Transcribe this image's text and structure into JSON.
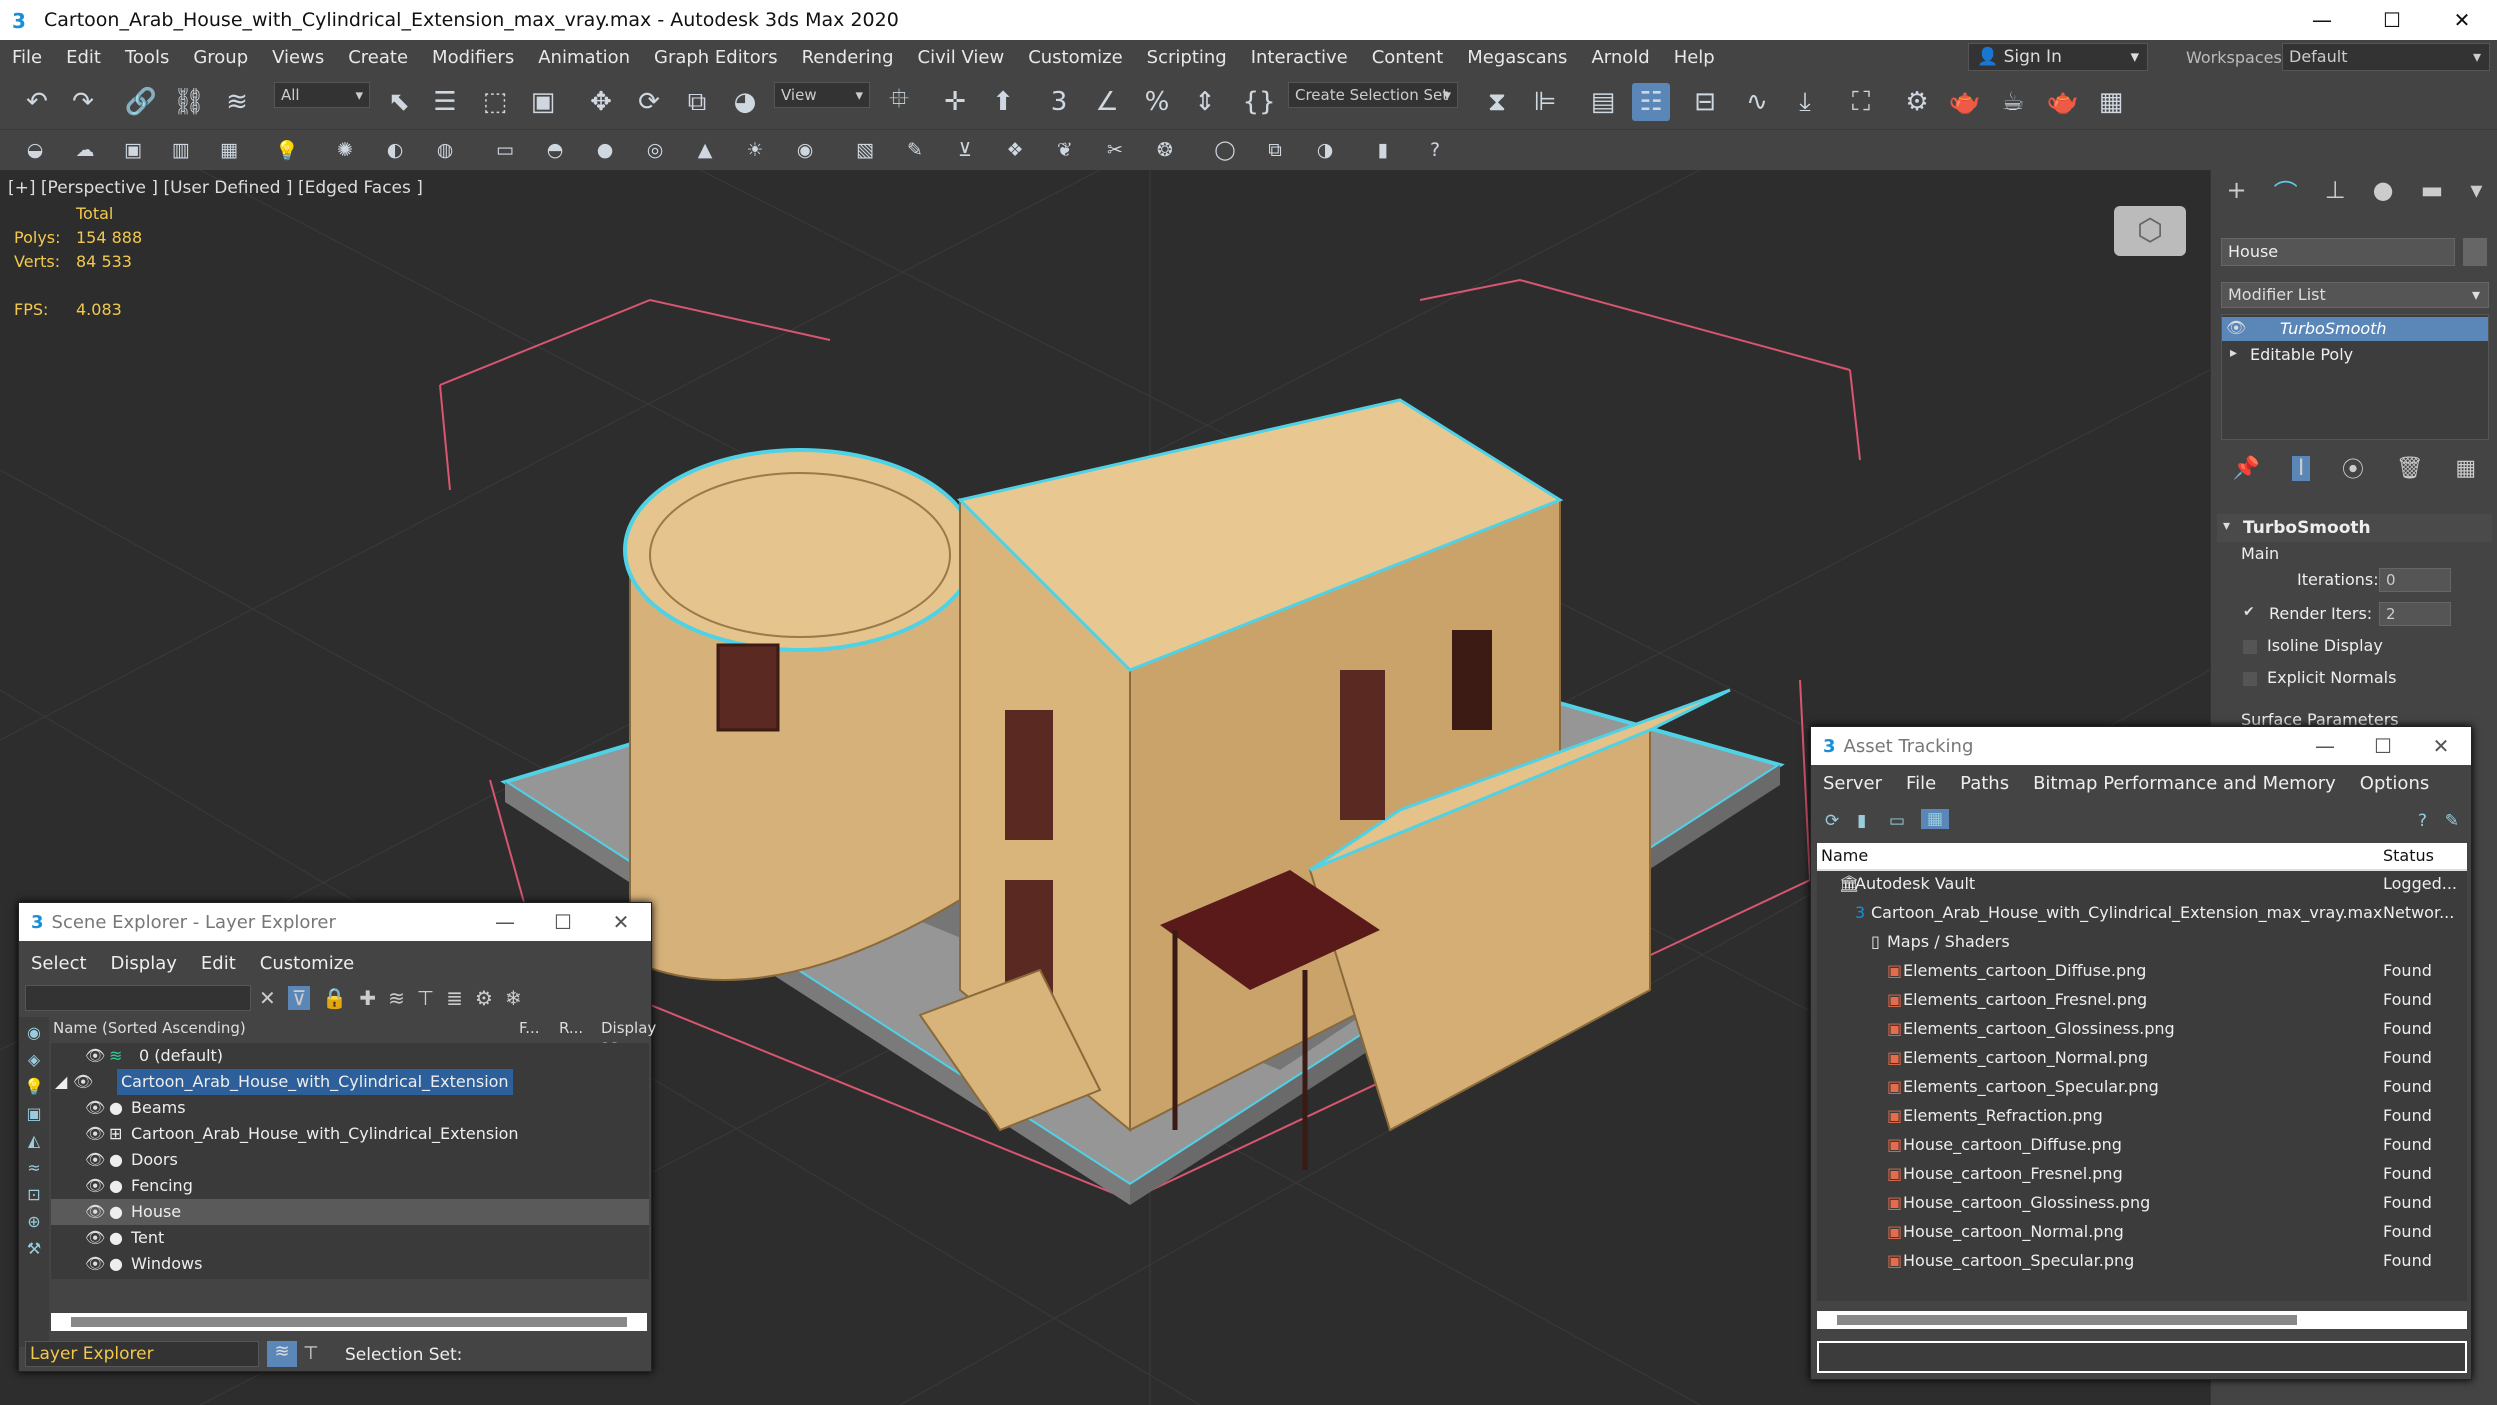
{
  "window": {
    "title": "Cartoon_Arab_House_with_Cylindrical_Extension_max_vray.max - Autodesk 3ds Max 2020",
    "minimize": "—",
    "maximize": "☐",
    "close": "✕"
  },
  "menu": [
    "File",
    "Edit",
    "Tools",
    "Group",
    "Views",
    "Create",
    "Modifiers",
    "Animation",
    "Graph Editors",
    "Rendering",
    "Civil View",
    "Customize",
    "Scripting",
    "Interactive",
    "Content",
    "Megascans",
    "Arnold",
    "Help"
  ],
  "signin": "Sign In",
  "workspaces": {
    "label": "Workspaces:",
    "value": "Default"
  },
  "toolbar": {
    "filter": "All",
    "refcoord": "View",
    "selection_set": "Create Selection Set"
  },
  "viewport": {
    "label": "[+] [Perspective ] [User Defined ] [Edged Faces ]",
    "stats": {
      "total_label": "Total",
      "polys_label": "Polys:",
      "polys": "154 888",
      "verts_label": "Verts:",
      "verts": "84 533",
      "fps_label": "FPS:",
      "fps": "4.083"
    }
  },
  "command_panel": {
    "object_name": "House",
    "modifier_list": "Modifier List",
    "stack": [
      "TurboSmooth",
      "Editable Poly"
    ],
    "rollout": "TurboSmooth",
    "main": "Main",
    "iterations_label": "Iterations:",
    "iterations": "0",
    "render_iters_label": "Render Iters:",
    "render_iters": "2",
    "isoline": "Isoline Display",
    "explicit": "Explicit Normals",
    "surface": "Surface Parameters"
  },
  "scene_explorer": {
    "title": "Scene Explorer - Layer Explorer",
    "menu": [
      "Select",
      "Display",
      "Edit",
      "Customize"
    ],
    "columns": [
      "Name (Sorted Ascending)",
      "F...",
      "R...",
      "Display as ..."
    ],
    "rows": [
      "0 (default)",
      "Cartoon_Arab_House_with_Cylindrical_Extension",
      "Beams",
      "Cartoon_Arab_House_with_Cylindrical_Extension",
      "Doors",
      "Fencing",
      "House",
      "Tent",
      "Windows"
    ],
    "footer_dropdown": "Layer Explorer",
    "selection_set": "Selection Set:"
  },
  "asset_tracking": {
    "title": "Asset Tracking",
    "menu": [
      "Server",
      "File",
      "Paths",
      "Bitmap Performance and Memory",
      "Options"
    ],
    "columns": [
      "Name",
      "Status"
    ],
    "rows": [
      {
        "name": "Autodesk Vault",
        "status": "Logged..."
      },
      {
        "name": "Cartoon_Arab_House_with_Cylindrical_Extension_max_vray.max",
        "status": "Networ..."
      },
      {
        "name": "Maps / Shaders",
        "status": ""
      },
      {
        "name": "Elements_cartoon_Diffuse.png",
        "status": "Found"
      },
      {
        "name": "Elements_cartoon_Fresnel.png",
        "status": "Found"
      },
      {
        "name": "Elements_cartoon_Glossiness.png",
        "status": "Found"
      },
      {
        "name": "Elements_cartoon_Normal.png",
        "status": "Found"
      },
      {
        "name": "Elements_cartoon_Specular.png",
        "status": "Found"
      },
      {
        "name": "Elements_Refraction.png",
        "status": "Found"
      },
      {
        "name": "House_cartoon_Diffuse.png",
        "status": "Found"
      },
      {
        "name": "House_cartoon_Fresnel.png",
        "status": "Found"
      },
      {
        "name": "House_cartoon_Glossiness.png",
        "status": "Found"
      },
      {
        "name": "House_cartoon_Normal.png",
        "status": "Found"
      },
      {
        "name": "House_cartoon_Specular.png",
        "status": "Found"
      }
    ]
  }
}
